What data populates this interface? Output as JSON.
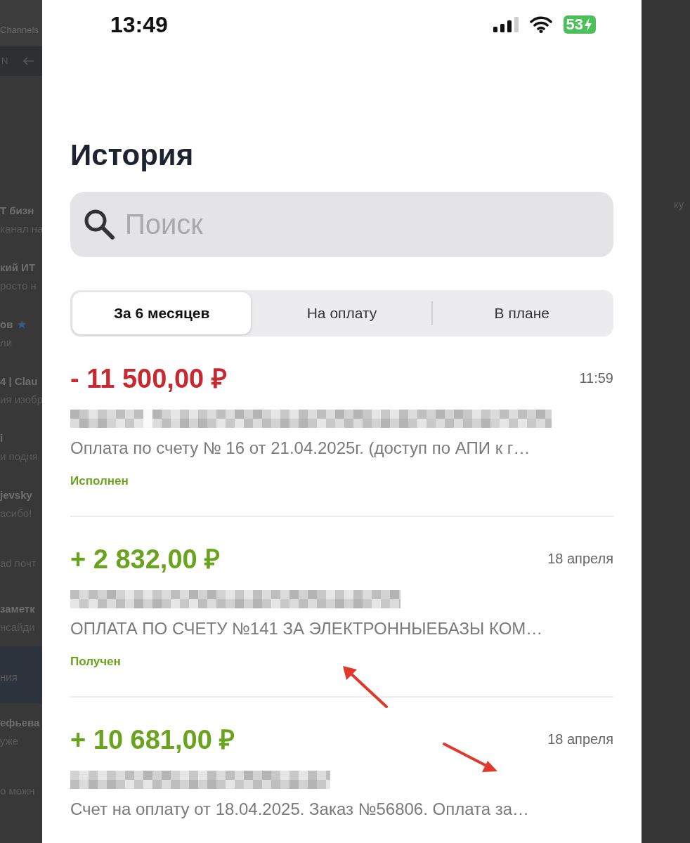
{
  "background": {
    "header": {
      "title": "Channels",
      "nav_text": "N"
    },
    "chats": [
      {
        "name": "Т бизн",
        "preview": "канал на",
        "starred": false,
        "selected": false
      },
      {
        "name": "кий ИТ",
        "preview": "росто н",
        "starred": false,
        "selected": false
      },
      {
        "name": "ов",
        "preview": "ли",
        "starred": true,
        "selected": false
      },
      {
        "name": "4 | Clau",
        "preview": "ия изобр",
        "starred": false,
        "selected": false
      },
      {
        "name": "i",
        "preview": "и подня",
        "starred": false,
        "selected": false
      },
      {
        "name": "jevsky",
        "preview": "асибо!",
        "starred": false,
        "selected": false
      },
      {
        "preview": "ad почт",
        "starred": false,
        "selected": false
      },
      {
        "name": "заметк",
        "preview": "нсайди",
        "starred": false,
        "selected": false
      },
      {
        "preview": "ния",
        "starred": false,
        "selected": true
      },
      {
        "name": "ефьева",
        "preview": "уже",
        "starred": false,
        "selected": false
      },
      {
        "preview": "о можн",
        "starred": false,
        "selected": false
      }
    ],
    "right_text": "ку"
  },
  "status_bar": {
    "time": "13:49",
    "battery": "53",
    "charging": true
  },
  "title": "История",
  "search": {
    "placeholder": "Поиск"
  },
  "tabs": [
    {
      "label": "За 6 месяцев",
      "selected": true
    },
    {
      "label": "На оплату",
      "selected": false
    },
    {
      "label": "В плане",
      "selected": false
    }
  ],
  "transactions": [
    {
      "amount": "- 11 500,00 ₽",
      "kind": "debit",
      "time": "11:59",
      "description": "Оплата по счету № 16 от 21.04.2025г. (доступ по АПИ к г…",
      "status": "Исполнен"
    },
    {
      "amount": "+ 2 832,00 ₽",
      "kind": "credit",
      "time": "18 апреля",
      "description": "ОПЛАТА ПО СЧЕТУ №141 ЗА ЭЛЕКТРОННЫЕБАЗЫ КОМ…",
      "status": "Получен"
    },
    {
      "amount": "+ 10 681,00 ₽",
      "kind": "credit",
      "time": "18 апреля",
      "description": "Счет на оплату от 18.04.2025. Заказ №56806. Оплата за…"
    }
  ],
  "annotations": [
    {
      "kind": "arrow",
      "color": "#e0392b"
    },
    {
      "kind": "arrow",
      "color": "#e0392b"
    }
  ]
}
